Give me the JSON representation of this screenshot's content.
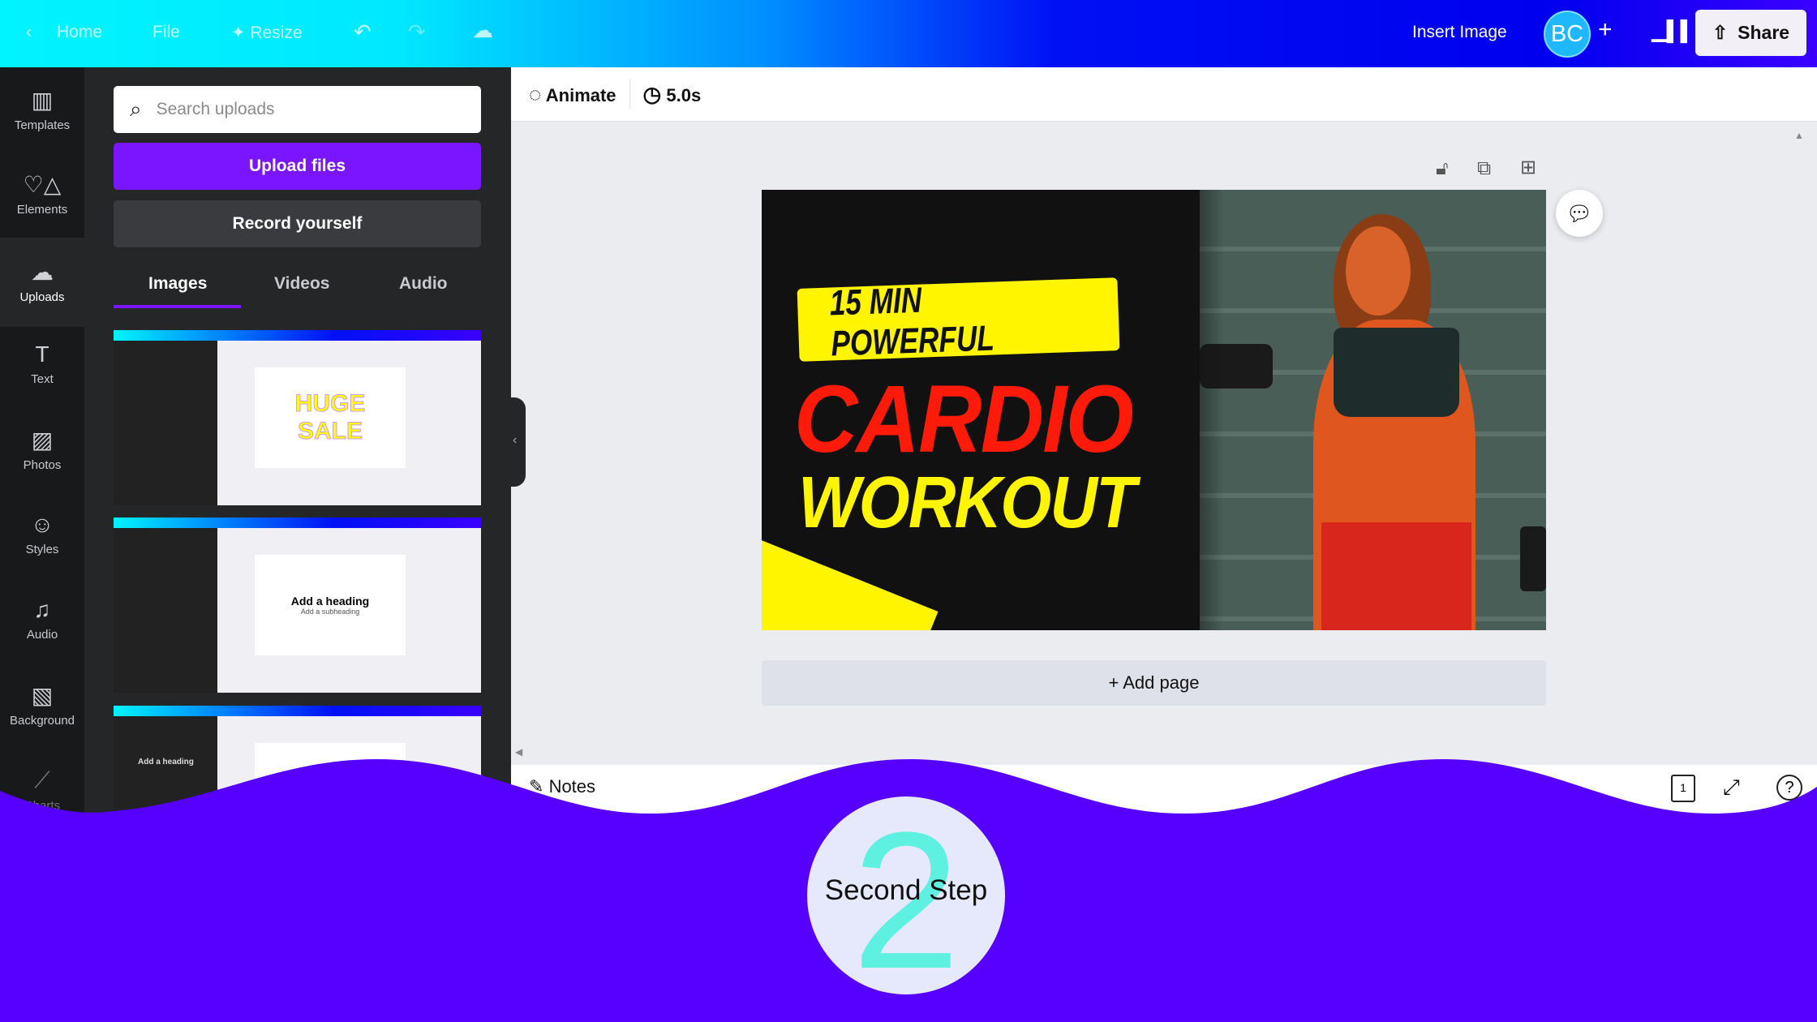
{
  "topbar": {
    "back_icon": "chevron-left-icon",
    "home": "Home",
    "file": "File",
    "resize": "Resize",
    "insert_image": "Insert Image",
    "avatar": "BC",
    "add": "+",
    "share": "Share"
  },
  "rail": [
    {
      "label": "Templates",
      "icon": "▥"
    },
    {
      "label": "Elements",
      "icon": "♡△"
    },
    {
      "label": "Uploads",
      "icon": "☁"
    },
    {
      "label": "Text",
      "icon": "T"
    },
    {
      "label": "Photos",
      "icon": "▨"
    },
    {
      "label": "Styles",
      "icon": "☺"
    },
    {
      "label": "Audio",
      "icon": "♫"
    },
    {
      "label": "Background",
      "icon": "▧"
    },
    {
      "label": "Charts",
      "icon": "⟋"
    }
  ],
  "panel": {
    "search_placeholder": "Search uploads",
    "upload": "Upload files",
    "record": "Record yourself",
    "tabs": [
      "Images",
      "Videos",
      "Audio"
    ],
    "thumbs": [
      {
        "t1": "HUGE",
        "t2": "SALE"
      },
      {
        "t1": "Add a heading",
        "t2": "Add a subheading"
      },
      {
        "t1": "Add a heading",
        "t2": ""
      }
    ]
  },
  "editor": {
    "animate": "Animate",
    "duration": "5.0s",
    "add_page": "+ Add page",
    "notes": "Notes",
    "page_count": "1"
  },
  "design": {
    "line1": "15 MIN POWERFUL",
    "line2": "CARDIO",
    "line3": "WORKOUT"
  },
  "overlay": {
    "number": "2",
    "caption": "Second Step"
  },
  "colors": {
    "accent": "#5600ff",
    "upload_btn": "#7a16ff",
    "wave": "#5600ff",
    "number": "#5ef0e0"
  }
}
